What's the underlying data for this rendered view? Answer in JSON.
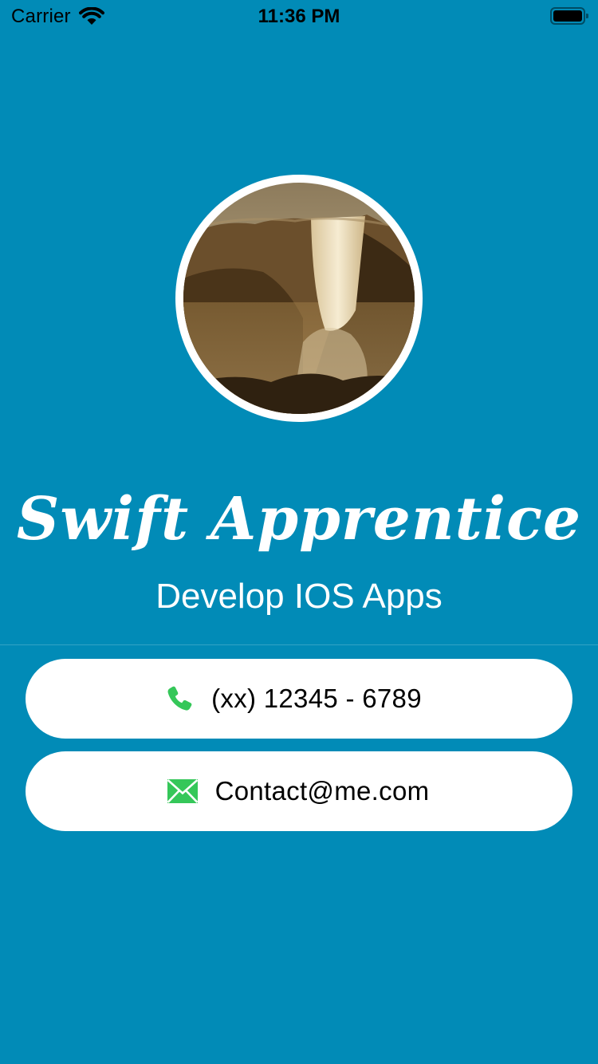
{
  "status_bar": {
    "carrier": "Carrier",
    "time": "11:36 PM",
    "icons": [
      "wifi-icon",
      "battery-icon"
    ]
  },
  "profile": {
    "avatar_icon": "waterfall-photo",
    "name": "Swift Apprentice",
    "tagline": "Develop IOS Apps"
  },
  "contacts": {
    "phone": {
      "icon": "phone-icon",
      "text": "(xx) 12345 - 6789"
    },
    "email": {
      "icon": "mail-icon",
      "text": "Contact@me.com"
    }
  },
  "colors": {
    "background": "#018bb7",
    "card": "#ffffff",
    "icon_accent": "#35c759",
    "text_light": "#ffffff",
    "text_dark": "#000000"
  }
}
